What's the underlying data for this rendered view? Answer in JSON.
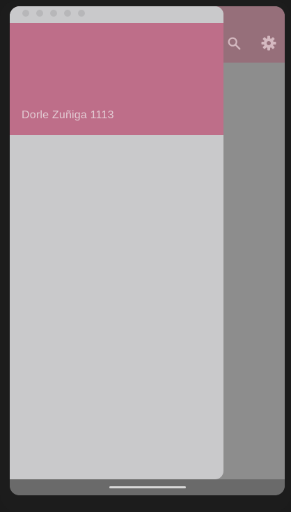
{
  "app_bar": {
    "actions": [
      {
        "icon": "search-icon"
      },
      {
        "icon": "gear-icon"
      }
    ]
  },
  "drawer": {
    "header_title": "Dorle Zuñiga 1113",
    "header_color": "#be6e89",
    "background_color": "#c9c9cb"
  }
}
